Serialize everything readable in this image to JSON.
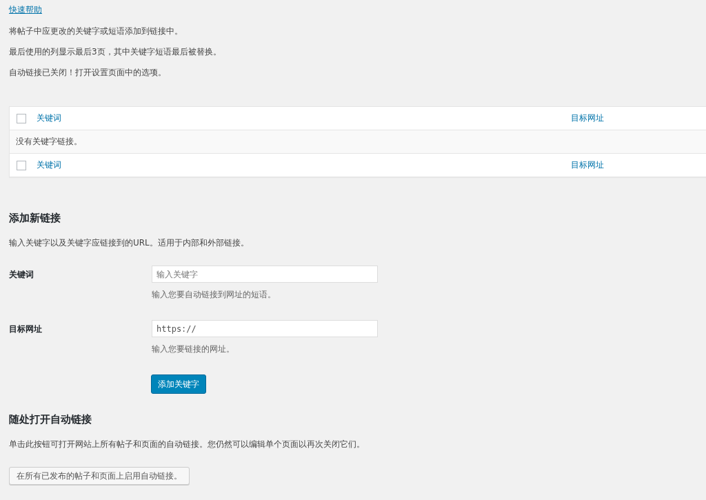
{
  "help_link": "快速帮助",
  "intro": [
    "将帖子中应更改的关键字或短语添加到链接中。",
    "最后使用的列显示最后3页，其中关键字短语最后被替换。",
    "自动链接已关闭！打开设置页面中的选项。"
  ],
  "table": {
    "header": {
      "checked": false,
      "columns": [
        "关键词",
        "目标网址"
      ]
    },
    "empty_message": "没有关键字链接。",
    "footer": {
      "checked": false,
      "columns": [
        "关键词",
        "目标网址"
      ]
    }
  },
  "add_section": {
    "heading": "添加新链接",
    "description": "输入关键字以及关键字应链接到的URL。适用于内部和外部链接。",
    "fields": [
      {
        "label": "关键词",
        "placeholder": "输入关键字",
        "hint": "输入您要自动链接到网址的短语。",
        "kind": "text"
      },
      {
        "label": "目标网址",
        "value": "https://",
        "hint": "输入您要链接的网址。",
        "kind": "url"
      }
    ],
    "button": "添加关键字"
  },
  "enable_section": {
    "heading": "随处打开自动链接",
    "description": "单击此按钮可打开网站上所有帖子和页面的自动链接。您仍然可以编辑单个页面以再次关闭它们。",
    "button": "在所有已发布的帖子和页面上启用自动链接。"
  }
}
